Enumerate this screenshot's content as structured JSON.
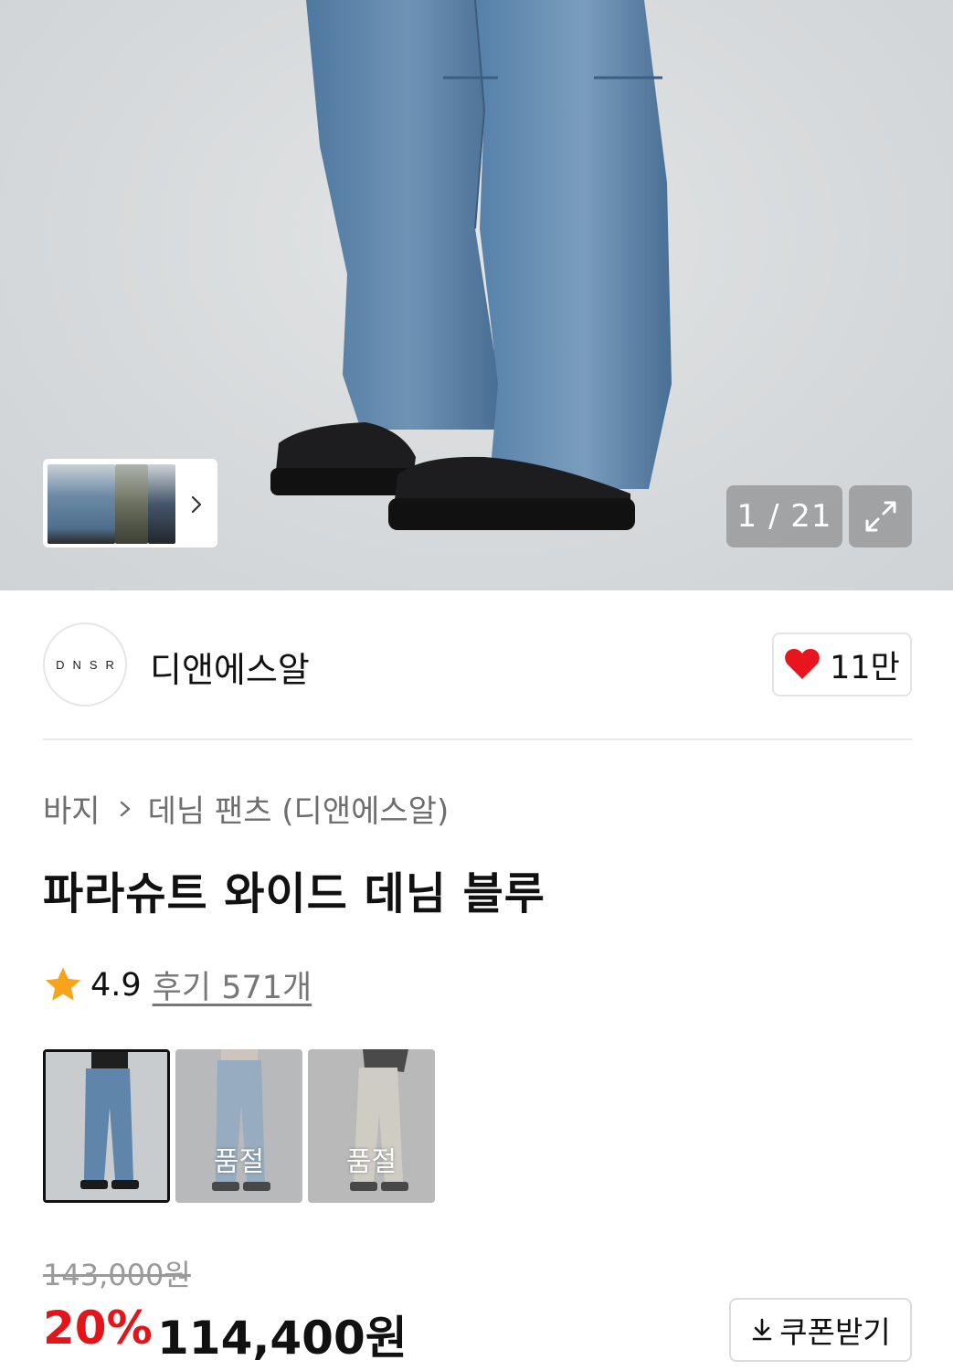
{
  "gallery": {
    "current": 1,
    "total": 21,
    "counter_text": "1 / 21"
  },
  "brand": {
    "logo_text": "DNSR",
    "name": "디앤에스알",
    "likes": "11만"
  },
  "breadcrumb": {
    "category": "바지",
    "subcategory": "데님 팬츠 (디앤에스알)"
  },
  "product": {
    "title": "파라슈트 와이드 데님 블루",
    "rating": "4.9",
    "reviews": "후기 571개"
  },
  "options": [
    {
      "selected": true,
      "soldout_label": ""
    },
    {
      "selected": false,
      "soldout_label": "품절"
    },
    {
      "selected": false,
      "soldout_label": "품절"
    }
  ],
  "price": {
    "original": "143,000원",
    "discount": "20%",
    "final": "114,400원"
  },
  "coupon": {
    "label": "쿠폰받기"
  },
  "colors": {
    "accent_red": "#e4141b",
    "star": "#f7a41b",
    "heart": "#e8141e"
  }
}
